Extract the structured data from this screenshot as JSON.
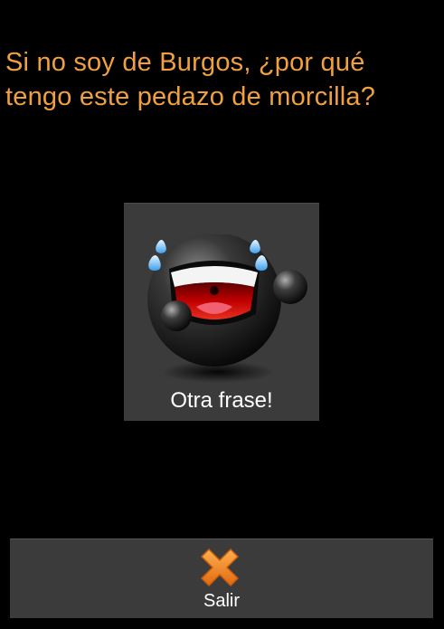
{
  "phrase": {
    "line1": "Si no soy de Burgos, ¿por qué",
    "line2": "tengo este pedazo de morcilla?",
    "color": "#f0a040"
  },
  "next_button": {
    "label": "Otra frase!",
    "icon": "laughing-crying-emoticon-icon"
  },
  "exit_button": {
    "label": "Salir",
    "icon": "close-x-icon",
    "icon_color": "#f28a1e"
  }
}
